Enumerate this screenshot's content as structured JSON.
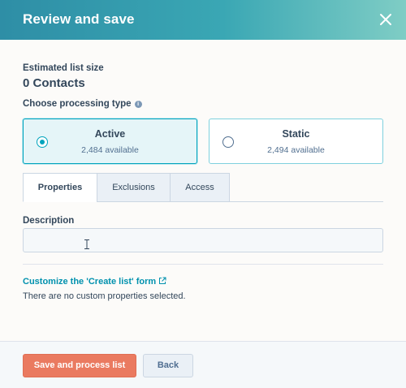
{
  "header": {
    "title": "Review and save",
    "close_icon": "close-icon"
  },
  "list_size": {
    "label": "Estimated list size",
    "value": "0 Contacts"
  },
  "processing": {
    "label": "Choose processing type",
    "info_icon": "info-icon",
    "options": [
      {
        "title": "Active",
        "subtitle": "2,484 available",
        "selected": true
      },
      {
        "title": "Static",
        "subtitle": "2,494 available",
        "selected": false
      }
    ]
  },
  "tabs": [
    {
      "label": "Properties",
      "selected": true
    },
    {
      "label": "Exclusions",
      "selected": false
    },
    {
      "label": "Access",
      "selected": false
    }
  ],
  "description": {
    "label": "Description",
    "value": "",
    "placeholder": ""
  },
  "customize": {
    "link_label": "Customize the 'Create list' form",
    "link_icon": "external-link-icon",
    "empty_text": "There are no custom properties selected."
  },
  "footer": {
    "primary_label": "Save and process list",
    "secondary_label": "Back"
  },
  "colors": {
    "accent": "#00a4bd",
    "primary_button": "#ea7a60",
    "link": "#0091ae",
    "text": "#33475b"
  }
}
